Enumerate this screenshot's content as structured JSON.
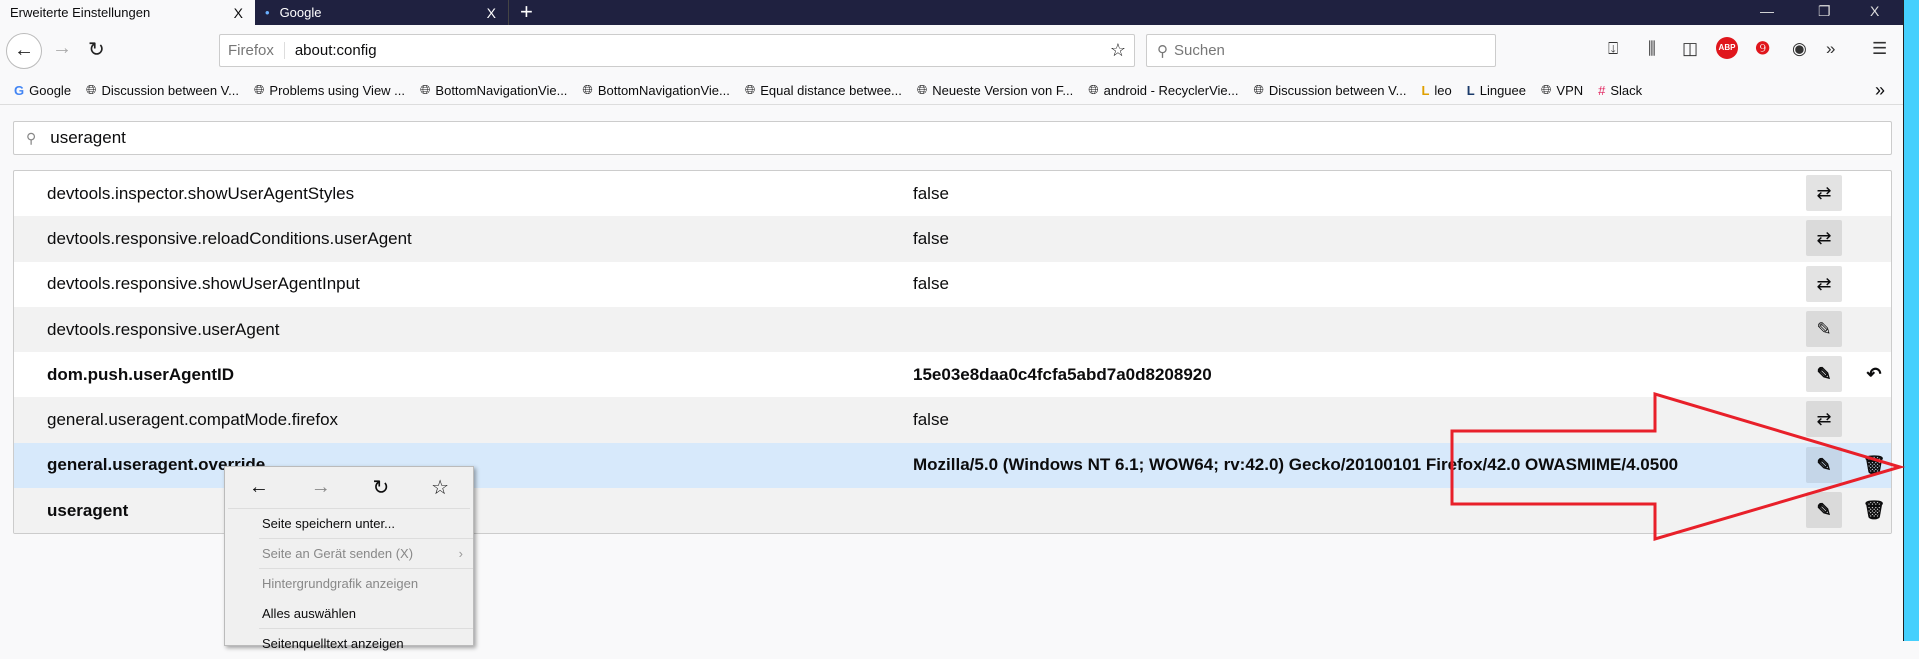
{
  "tabs": [
    {
      "label": "Erweiterte Einstellungen",
      "close": "X"
    },
    {
      "label": "Google",
      "close": "X",
      "dot": "•"
    }
  ],
  "window": {
    "new_tab": "+",
    "minimize": "—",
    "restore": "❐",
    "close": "X"
  },
  "navbar": {
    "identity": "Firefox",
    "url": "about:config",
    "search_placeholder": "Suchen"
  },
  "bookmarks": [
    {
      "label": "Google",
      "icon": "google-icon"
    },
    {
      "label": "Discussion between V...",
      "icon": "globe-icon"
    },
    {
      "label": "Problems using View ...",
      "icon": "globe-icon"
    },
    {
      "label": "BottomNavigationVie...",
      "icon": "globe-icon"
    },
    {
      "label": "BottomNavigationVie...",
      "icon": "globe-icon"
    },
    {
      "label": "Equal distance betwee...",
      "icon": "globe-icon"
    },
    {
      "label": "Neueste Version von F...",
      "icon": "globe-icon"
    },
    {
      "label": "android - RecyclerVie...",
      "icon": "globe-icon"
    },
    {
      "label": "Discussion between V...",
      "icon": "globe-icon"
    },
    {
      "label": "leo",
      "icon": "leo-icon"
    },
    {
      "label": "Linguee",
      "icon": "linguee-icon"
    },
    {
      "label": "VPN",
      "icon": "globe-icon"
    },
    {
      "label": "Slack",
      "icon": "slack-icon"
    }
  ],
  "filter": {
    "value": "useragent"
  },
  "prefs": [
    {
      "name": "devtools.inspector.showUserAgentStyles",
      "value": "false",
      "action": "toggle"
    },
    {
      "name": "devtools.responsive.reloadConditions.userAgent",
      "value": "false",
      "action": "toggle"
    },
    {
      "name": "devtools.responsive.showUserAgentInput",
      "value": "false",
      "action": "toggle"
    },
    {
      "name": "devtools.responsive.userAgent",
      "value": "",
      "action": "edit"
    },
    {
      "name": "dom.push.userAgentID",
      "value": "15e03e8daa0c4fcfa5abd7a0d8208920",
      "action": "edit",
      "extra": "reset"
    },
    {
      "name": "general.useragent.compatMode.firefox",
      "value": "false",
      "action": "toggle"
    },
    {
      "name": "general.useragent.override",
      "value": "Mozilla/5.0 (Windows NT 6.1; WOW64; rv:42.0) Gecko/20100101 Firefox/42.0 OWASMIME/4.0500",
      "action": "edit",
      "extra": "delete"
    },
    {
      "name": "useragent",
      "value": "",
      "action": "edit",
      "extra": "delete"
    }
  ],
  "context_menu": {
    "items": [
      {
        "label": "Seite speichern unter...",
        "disabled": false
      },
      {
        "label": "Seite an Gerät senden (X)",
        "disabled": true,
        "submenu": "›"
      },
      {
        "label": "Hintergrundgrafik anzeigen",
        "disabled": true
      },
      {
        "label": "Alles auswählen",
        "disabled": false
      },
      {
        "label": "Seitenquelltext anzeigen",
        "disabled": false
      }
    ]
  },
  "annotation_color": "#e8202a"
}
